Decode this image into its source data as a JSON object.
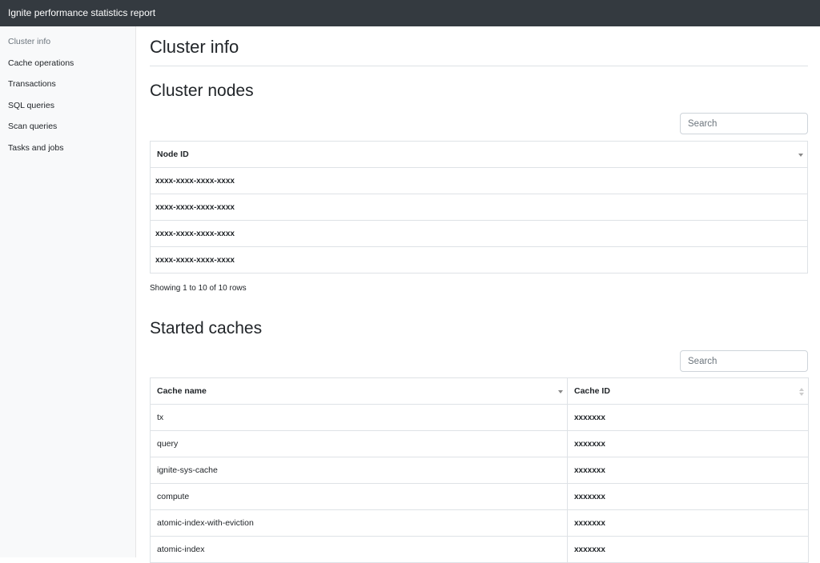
{
  "header": {
    "title": "Ignite performance statistics report"
  },
  "sidebar": {
    "items": [
      {
        "label": "Cluster info"
      },
      {
        "label": "Cache operations"
      },
      {
        "label": "Transactions"
      },
      {
        "label": "SQL queries"
      },
      {
        "label": "Scan queries"
      },
      {
        "label": "Tasks and jobs"
      }
    ]
  },
  "main": {
    "title": "Cluster info",
    "cluster_nodes": {
      "heading": "Cluster nodes",
      "search_placeholder": "Search",
      "column": "Node ID",
      "rows": [
        "xxxx-xxxx-xxxx-xxxx",
        "xxxx-xxxx-xxxx-xxxx",
        "xxxx-xxxx-xxxx-xxxx",
        "xxxx-xxxx-xxxx-xxxx"
      ],
      "pagination": "Showing 1 to 10 of 10 rows"
    },
    "started_caches": {
      "heading": "Started caches",
      "search_placeholder": "Search",
      "columns": [
        "Cache name",
        "Cache ID"
      ],
      "rows": [
        {
          "name": "tx",
          "id": "xxxxxxx"
        },
        {
          "name": "query",
          "id": "xxxxxxx"
        },
        {
          "name": "ignite-sys-cache",
          "id": "xxxxxxx"
        },
        {
          "name": "compute",
          "id": "xxxxxxx"
        },
        {
          "name": "atomic-index-with-eviction",
          "id": "xxxxxxx"
        },
        {
          "name": "atomic-index",
          "id": "xxxxxxx"
        }
      ]
    }
  }
}
